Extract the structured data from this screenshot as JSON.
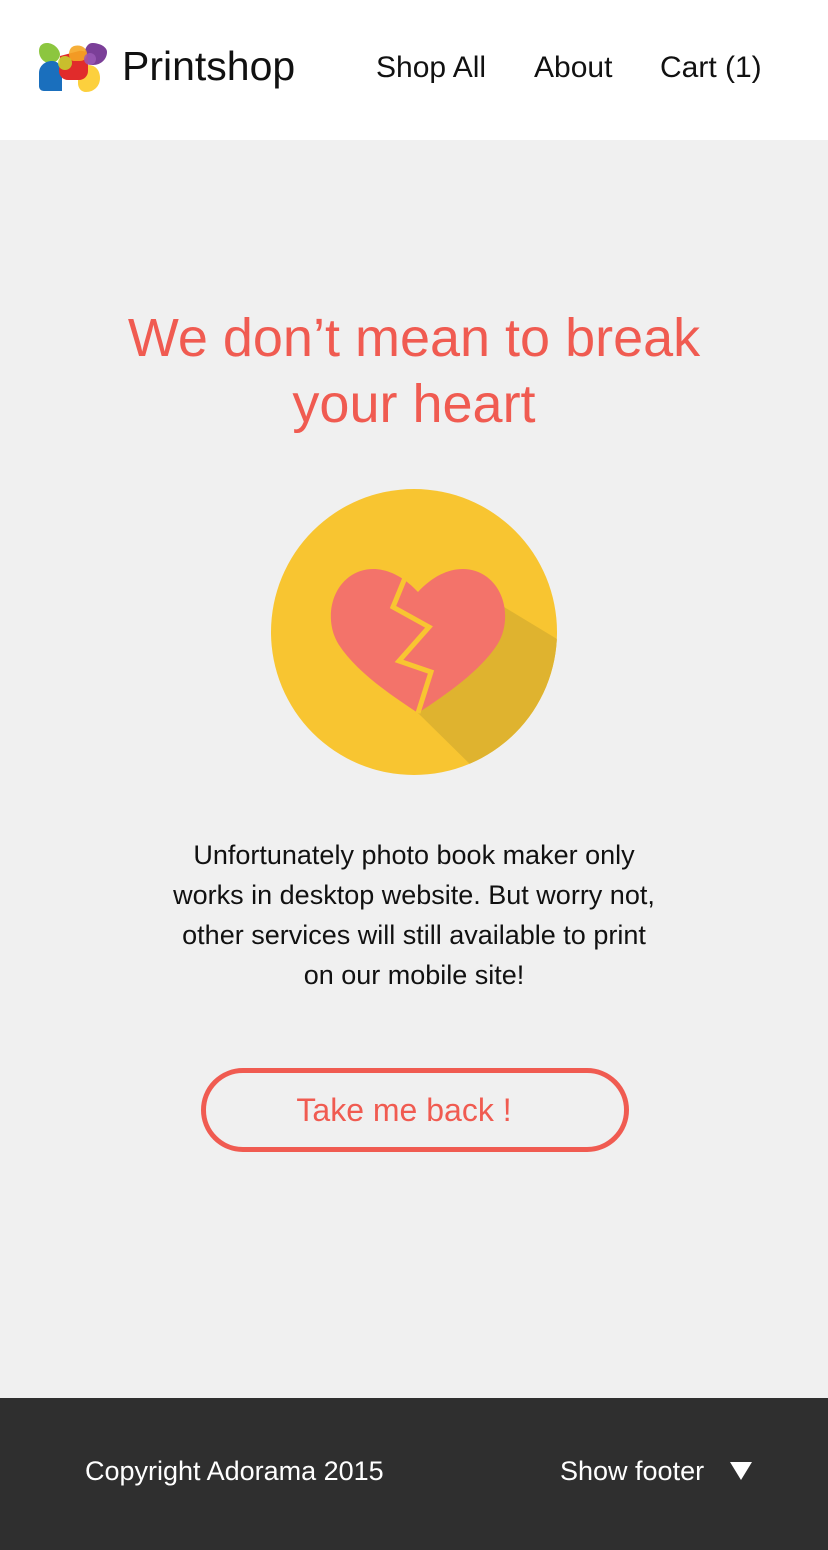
{
  "header": {
    "brand": "Printshop",
    "logo_icon": "printshop-logo",
    "nav": [
      {
        "label": "Shop All"
      },
      {
        "label": "About"
      },
      {
        "label": "Cart (1)"
      }
    ]
  },
  "main": {
    "headline_line1": "We don’t mean to break",
    "headline_line2": "your heart",
    "illustration_icon": "broken-heart-icon",
    "message_lines": [
      "Unfortunately photo book maker only",
      "works in desktop website. But worry not,",
      "other services will still available to print",
      "on our mobile site!"
    ],
    "button_label": "Take me back !"
  },
  "footer": {
    "copyright": "Copyright Adorama 2015",
    "toggle_label": "Show footer",
    "toggle_icon": "triangle-down-icon"
  },
  "colors": {
    "accent": "#f05b51",
    "circle": "#f8c531",
    "heart": "#f3736a",
    "page_background": "#f0f0f0",
    "footer_background": "#2f2f2f"
  }
}
